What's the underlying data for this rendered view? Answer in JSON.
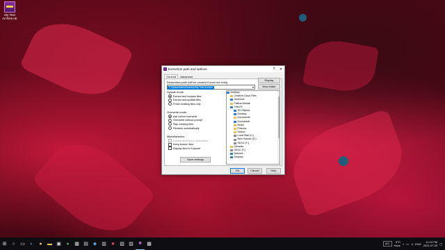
{
  "desktop": {
    "icon_label": "My Test Archive.rar"
  },
  "dialog": {
    "title": "Extraction path and options",
    "help_btn": "?",
    "close_btn": "✕",
    "tabs": [
      "General",
      "Advanced"
    ],
    "dest_label": "Destination path (will be created if does not exist)",
    "dest_value": "C:\\Users\\fatim\\Desktop\\My Test Archive",
    "display_btn": "Display",
    "new_folder_btn": "New folder",
    "update_mode": {
      "title": "Update mode",
      "options": [
        "Extract and replace files",
        "Extract and update files",
        "Fresh existing files only"
      ]
    },
    "overwrite_mode": {
      "title": "Overwrite mode",
      "options": [
        "Ask before overwrite",
        "Overwrite without prompt",
        "Skip existing files",
        "Rename automatically"
      ]
    },
    "misc": {
      "title": "Miscellaneous",
      "options": [
        "Extract archives to subfolders",
        "Keep broken files",
        "Display files in Explorer"
      ]
    },
    "save_btn": "Save settings",
    "tree": [
      "Desktop",
      "Creative Cloud Files",
      "OneDrive",
      "Fatima Wahab",
      "This PC",
      "3D Objects",
      "Desktop",
      "Documents",
      "Downloads",
      "Music",
      "Pictures",
      "Videos",
      "Local Disk (C:)",
      "New Volume (D:)",
      "SDXC (F:)",
      "Libraries",
      "SDXC (F:)",
      "Network",
      "Desktop"
    ],
    "ok_btn": "OK",
    "cancel_btn": "Cancel",
    "help2_btn": "Help"
  },
  "taskbar": {
    "weather": "A/C",
    "temp": "8°C",
    "temp2": "Haze",
    "lang": "ENG",
    "time": "11:19 PM",
    "date": "2021-07-03"
  }
}
